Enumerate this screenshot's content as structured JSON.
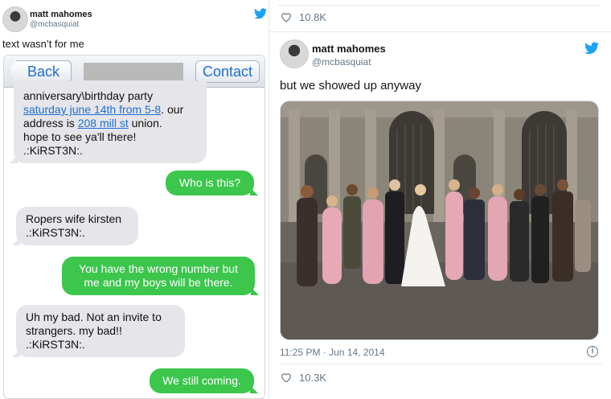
{
  "left_tweet": {
    "name": "matt mahomes",
    "handle": "@mcbasquiat",
    "text": "text wasn’t for me",
    "phone": {
      "back_label": "Back",
      "contact_label": "Contact",
      "messages": [
        {
          "direction": "in",
          "line1": "anniversary\\birthday party",
          "link1": "saturday june 14th from 5-8",
          "mid": ". our",
          "line3a": "address is ",
          "link2": "208 mill st",
          "line3b": " union.",
          "line4": "hope to see ya'll there!",
          "line5": ".:KiRST3N:."
        },
        {
          "direction": "out",
          "text": "Who is this?"
        },
        {
          "direction": "in",
          "line1": "Ropers wife kirsten",
          "line2": ".:KiRST3N:."
        },
        {
          "direction": "out",
          "line1": "You have the wrong number but",
          "line2": "me and my boys will be there."
        },
        {
          "direction": "in",
          "line1": "Uh my bad. Not an invite to",
          "line2": "strangers. my bad!!",
          "line3": ".:KiRST3N:."
        },
        {
          "direction": "out",
          "text": "We still coming."
        }
      ]
    }
  },
  "right_tweet": {
    "likes_top": "10.8K",
    "name": "matt mahomes",
    "handle": "@mcbasquiat",
    "text": "but we showed up anyway",
    "timestamp": "11:25 PM · Jun 14, 2014",
    "likes_bottom": "10.3K"
  },
  "colors": {
    "twitter_blue": "#1da1f2",
    "imessage_green": "#3cc64c",
    "imessage_gray": "#e5e5ea",
    "ios_link": "#1f6fd1"
  },
  "icons": [
    "twitter-bird-icon",
    "heart-icon",
    "info-icon",
    "avatar"
  ]
}
